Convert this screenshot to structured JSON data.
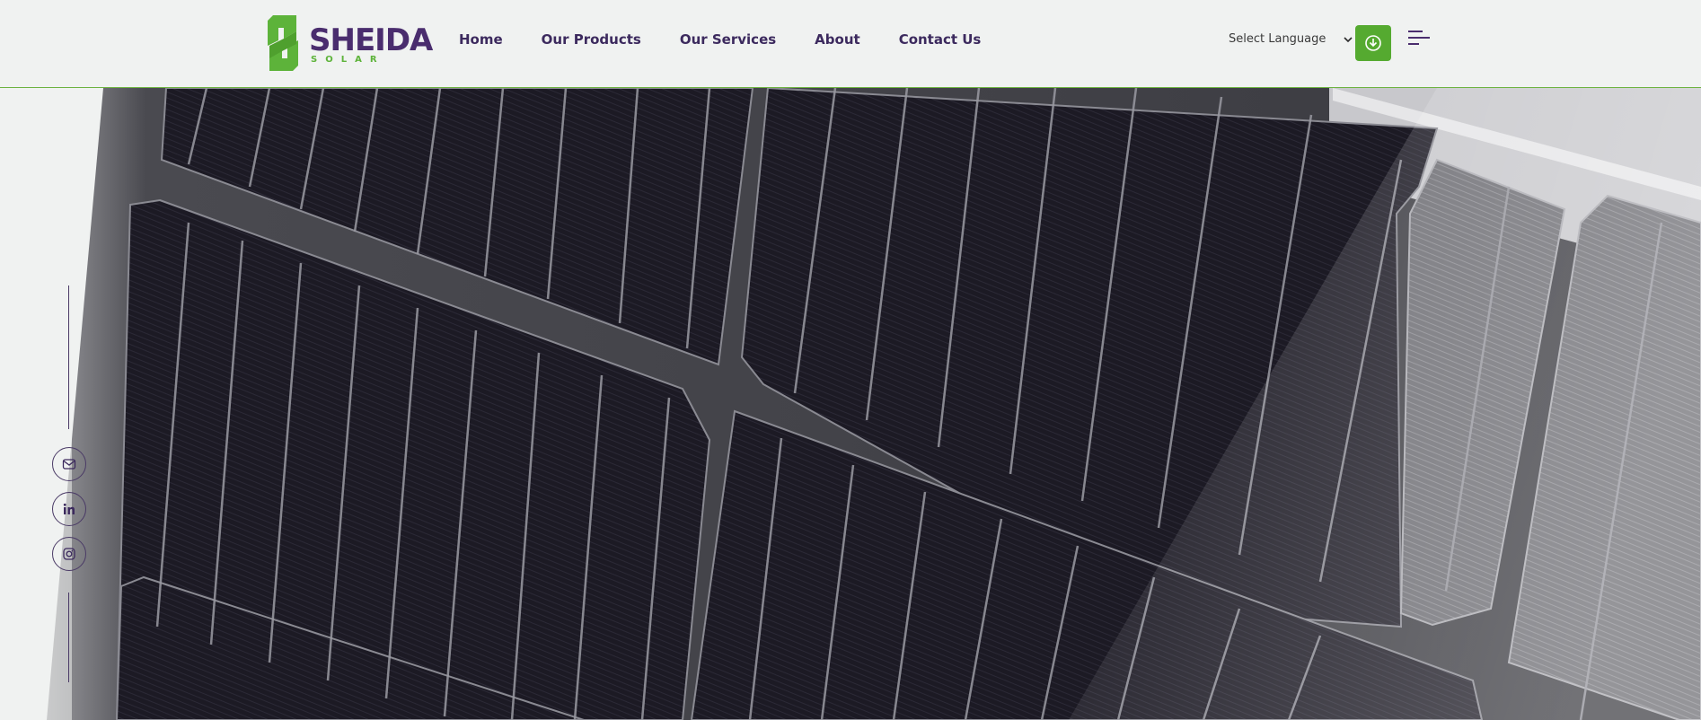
{
  "brand": {
    "name": "SHEIDA",
    "tagline": "SOLAR",
    "primary_color": "#4a2d6e",
    "accent_color": "#5db33a"
  },
  "nav": {
    "items": [
      {
        "label": "Home"
      },
      {
        "label": "Our Products"
      },
      {
        "label": "Our Services"
      },
      {
        "label": "About"
      },
      {
        "label": "Contact Us"
      }
    ]
  },
  "header_actions": {
    "language_label": "Select Language",
    "language_icon": "chevron-down-icon",
    "download_icon": "download-icon",
    "menu_icon": "hamburger-menu-icon"
  },
  "social": {
    "items": [
      {
        "icon": "email-icon"
      },
      {
        "icon": "linkedin-icon"
      },
      {
        "icon": "instagram-icon"
      }
    ]
  },
  "hero": {
    "image": "solar-panel-closeup"
  }
}
